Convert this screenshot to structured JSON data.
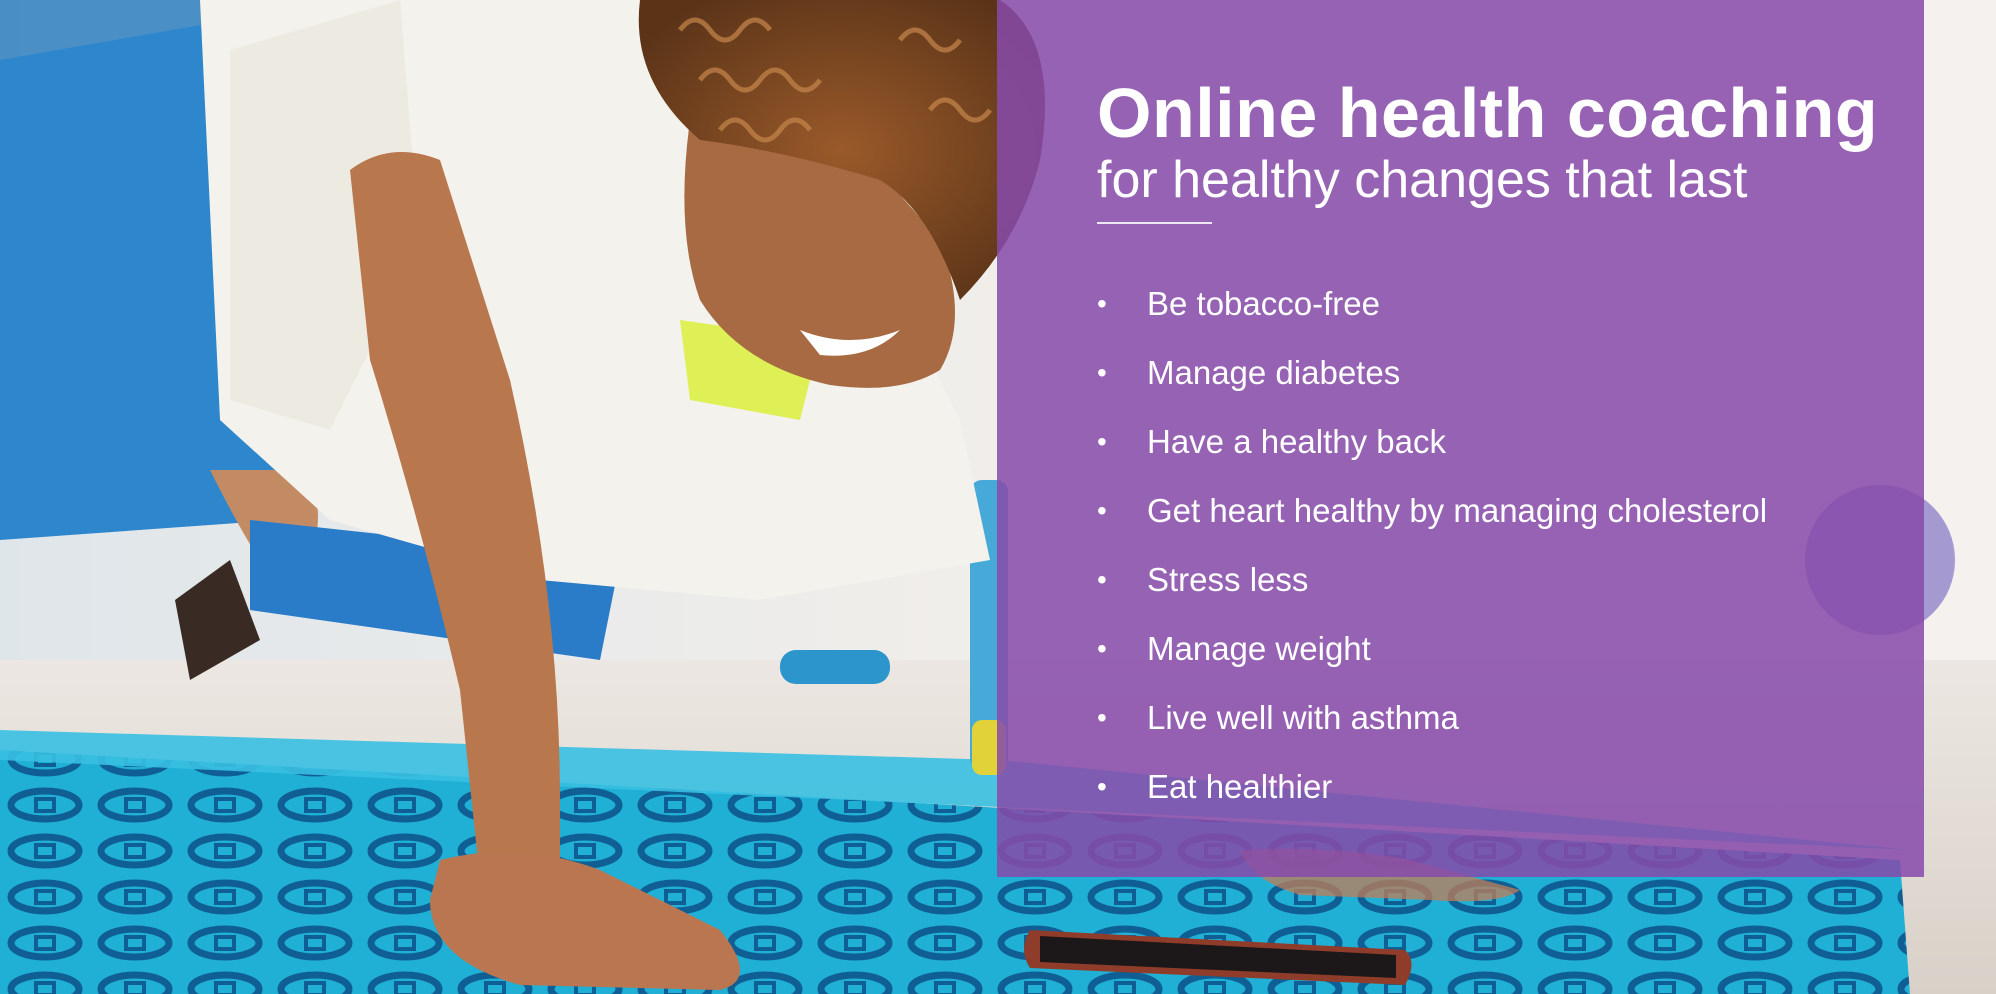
{
  "hero": {
    "title": "Online health coaching",
    "subtitle": "for healthy changes that last",
    "colors": {
      "panel": "#874baa",
      "text": "#ffffff",
      "mat": "#1fb3d8",
      "mat_pattern": "#0f5f95",
      "shirt": "#f4f2ec",
      "leggings": "#2f8fd1"
    },
    "bullets": [
      "Be tobacco-free",
      "Manage diabetes",
      "Have a healthy back",
      "Get heart healthy by managing cholesterol",
      "Stress less",
      "Manage weight",
      "Live well with asthma",
      "Eat healthier"
    ]
  }
}
